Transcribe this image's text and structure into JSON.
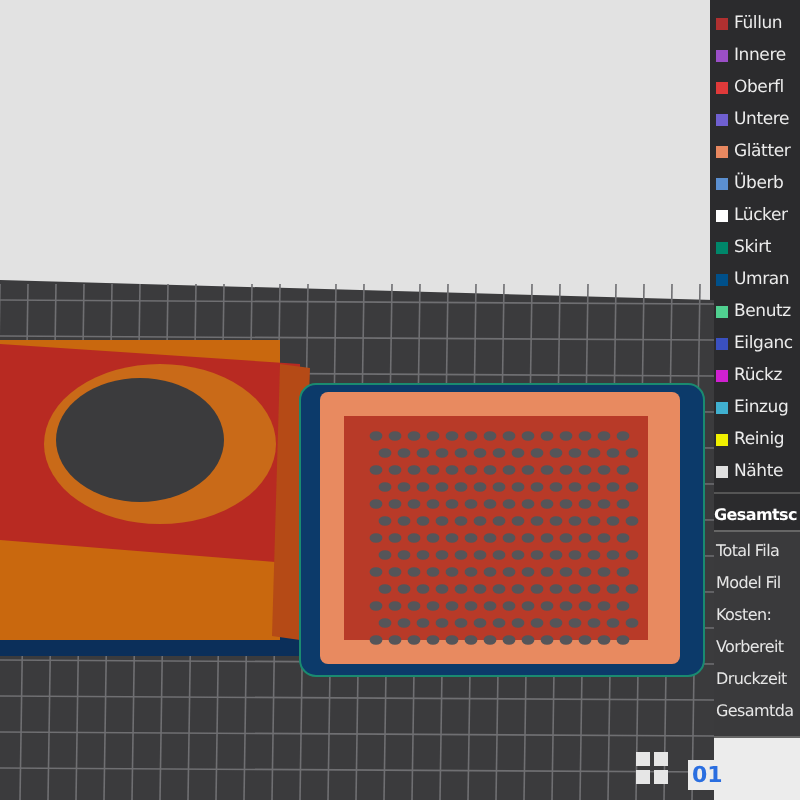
{
  "legend": {
    "items": [
      {
        "label": "Füllun",
        "color": "#b03030"
      },
      {
        "label": "Innere",
        "color": "#9b4fc7"
      },
      {
        "label": "Oberfl",
        "color": "#e03a3a"
      },
      {
        "label": "Untere",
        "color": "#7060d0"
      },
      {
        "label": "Glätter",
        "color": "#e88860"
      },
      {
        "label": "Überb",
        "color": "#5b8fd0"
      },
      {
        "label": "Lücker",
        "color": "#ffffff"
      },
      {
        "label": "Skirt",
        "color": "#00876a"
      },
      {
        "label": "Umran",
        "color": "#00508a"
      },
      {
        "label": "Benutz",
        "color": "#50d090"
      },
      {
        "label": "Eilganc",
        "color": "#3a50c0"
      },
      {
        "label": "Rückz",
        "color": "#d020d0"
      },
      {
        "label": "Einzug",
        "color": "#40b0d0"
      },
      {
        "label": "Reinig",
        "color": "#f0f000"
      },
      {
        "label": "Nähte",
        "color": "#e0e0e0"
      }
    ]
  },
  "summary": {
    "title": "Gesamtsc",
    "rows": [
      "Total Fila",
      "Model Fil",
      "Kosten:",
      "Vorbereit",
      "Druckzeit",
      "Gesamtda"
    ]
  },
  "view": {
    "layer_label": "01"
  }
}
